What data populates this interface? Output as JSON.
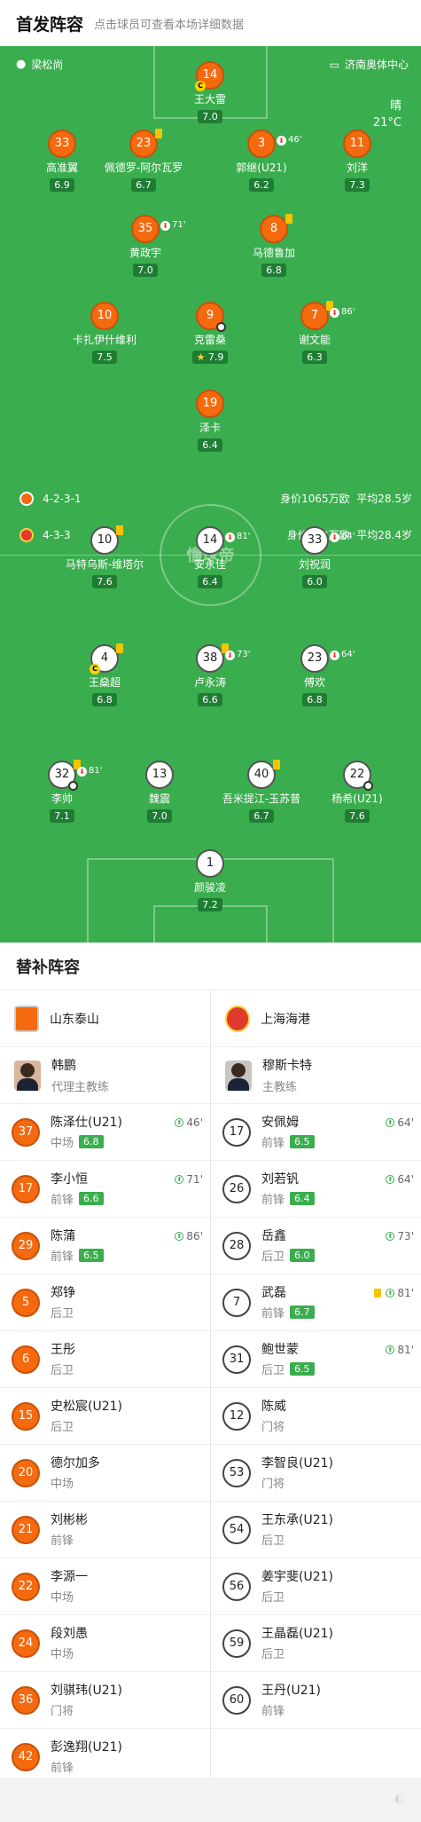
{
  "header": {
    "title": "首发阵容",
    "subtitle": "点击球员可查看本场详细数据"
  },
  "weather": {
    "cond": "晴",
    "temp": "21°C"
  },
  "home": {
    "name": "梁松尚",
    "venue": "济南奥体中心",
    "formation": "4-2-3-1",
    "value": "身价1065万欧",
    "age": "平均28.5岁",
    "team": "山东泰山",
    "coach_name": "韩鹏",
    "coach_role": "代理主教练",
    "color": "#f56a0f"
  },
  "away": {
    "formation": "4-3-3",
    "value": "身价602万欧",
    "age": "平均28.4岁",
    "team": "上海海港",
    "coach_name": "穆斯卡特",
    "coach_role": "主教练",
    "color": "#e03a2e"
  },
  "pitch_watermark": "懂球帝",
  "home_players": [
    {
      "num": "14",
      "name": "王大雷",
      "rating": "7.0",
      "captain": true
    },
    {
      "num": "33",
      "name": "高准翼",
      "rating": "6.9"
    },
    {
      "num": "23",
      "name": "佩德罗-阿尔瓦罗",
      "rating": "6.7",
      "yellow": true
    },
    {
      "num": "3",
      "name": "郭继(U21)",
      "rating": "6.2",
      "sub": "46'"
    },
    {
      "num": "11",
      "name": "刘洋",
      "rating": "7.3"
    },
    {
      "num": "35",
      "name": "黄政宇",
      "rating": "7.0",
      "sub": "71'"
    },
    {
      "num": "8",
      "name": "马德鲁加",
      "rating": "6.8",
      "yellow": true
    },
    {
      "num": "10",
      "name": "卡扎伊什维利",
      "rating": "7.5"
    },
    {
      "num": "9",
      "name": "克雷桑",
      "rating": "7.9",
      "goal": true,
      "star": true
    },
    {
      "num": "7",
      "name": "谢文能",
      "rating": "6.3",
      "yellow": true,
      "sub": "86'"
    },
    {
      "num": "19",
      "name": "泽卡",
      "rating": "6.4"
    }
  ],
  "away_players": [
    {
      "num": "10",
      "name": "马特乌斯-维塔尔",
      "rating": "7.6",
      "yellow": true
    },
    {
      "num": "14",
      "name": "安永佳",
      "rating": "6.4",
      "sub": "81'"
    },
    {
      "num": "33",
      "name": "刘祝润",
      "rating": "6.0",
      "sub": "64'"
    },
    {
      "num": "4",
      "name": "王燊超",
      "rating": "6.8",
      "yellow": true,
      "captain": true
    },
    {
      "num": "38",
      "name": "卢永涛",
      "rating": "6.6",
      "yellow": true,
      "sub": "73'"
    },
    {
      "num": "23",
      "name": "傅欢",
      "rating": "6.8",
      "sub": "64'"
    },
    {
      "num": "32",
      "name": "李帅",
      "rating": "7.1",
      "yellow": true,
      "sub": "81'",
      "assist": true
    },
    {
      "num": "13",
      "name": "魏震",
      "rating": "7.0"
    },
    {
      "num": "40",
      "name": "吾米提江-玉苏普",
      "rating": "6.7",
      "yellow": true
    },
    {
      "num": "22",
      "name": "杨希(U21)",
      "rating": "7.6",
      "goal": true
    },
    {
      "num": "1",
      "name": "颜骏凌",
      "rating": "7.2"
    }
  ],
  "subs_title": "替补阵容",
  "home_subs": [
    {
      "num": "37",
      "name": "陈泽仕(U21)",
      "pos": "中场",
      "rating": "6.8",
      "min": "46'"
    },
    {
      "num": "17",
      "name": "李小恒",
      "pos": "前锋",
      "rating": "6.6",
      "min": "71'"
    },
    {
      "num": "29",
      "name": "陈蒲",
      "pos": "前锋",
      "rating": "6.5",
      "min": "86'"
    },
    {
      "num": "5",
      "name": "郑铮",
      "pos": "后卫"
    },
    {
      "num": "6",
      "name": "王彤",
      "pos": "后卫"
    },
    {
      "num": "15",
      "name": "史松宸(U21)",
      "pos": "后卫"
    },
    {
      "num": "20",
      "name": "德尔加多",
      "pos": "中场"
    },
    {
      "num": "21",
      "name": "刘彬彬",
      "pos": "前锋"
    },
    {
      "num": "22",
      "name": "李源一",
      "pos": "中场"
    },
    {
      "num": "24",
      "name": "段刘愚",
      "pos": "中场"
    },
    {
      "num": "36",
      "name": "刘骐玮(U21)",
      "pos": "门将"
    },
    {
      "num": "42",
      "name": "彭逸翔(U21)",
      "pos": "前锋"
    }
  ],
  "away_subs": [
    {
      "num": "17",
      "name": "安佩姆",
      "pos": "前锋",
      "rating": "6.5",
      "min": "64'"
    },
    {
      "num": "26",
      "name": "刘若钒",
      "pos": "前锋",
      "rating": "6.4",
      "min": "64'"
    },
    {
      "num": "28",
      "name": "岳鑫",
      "pos": "后卫",
      "rating": "6.0",
      "min": "73'"
    },
    {
      "num": "7",
      "name": "武磊",
      "pos": "前锋",
      "rating": "6.7",
      "min": "81'",
      "yellow": true
    },
    {
      "num": "31",
      "name": "鲍世蒙",
      "pos": "后卫",
      "rating": "6.5",
      "min": "81'"
    },
    {
      "num": "12",
      "name": "陈威",
      "pos": "门将"
    },
    {
      "num": "53",
      "name": "李智良(U21)",
      "pos": "门将"
    },
    {
      "num": "54",
      "name": "王东承(U21)",
      "pos": "后卫"
    },
    {
      "num": "56",
      "name": "姜宇斐(U21)",
      "pos": "后卫"
    },
    {
      "num": "59",
      "name": "王晶磊(U21)",
      "pos": "后卫"
    },
    {
      "num": "60",
      "name": "王丹(U21)",
      "pos": "前锋"
    }
  ]
}
